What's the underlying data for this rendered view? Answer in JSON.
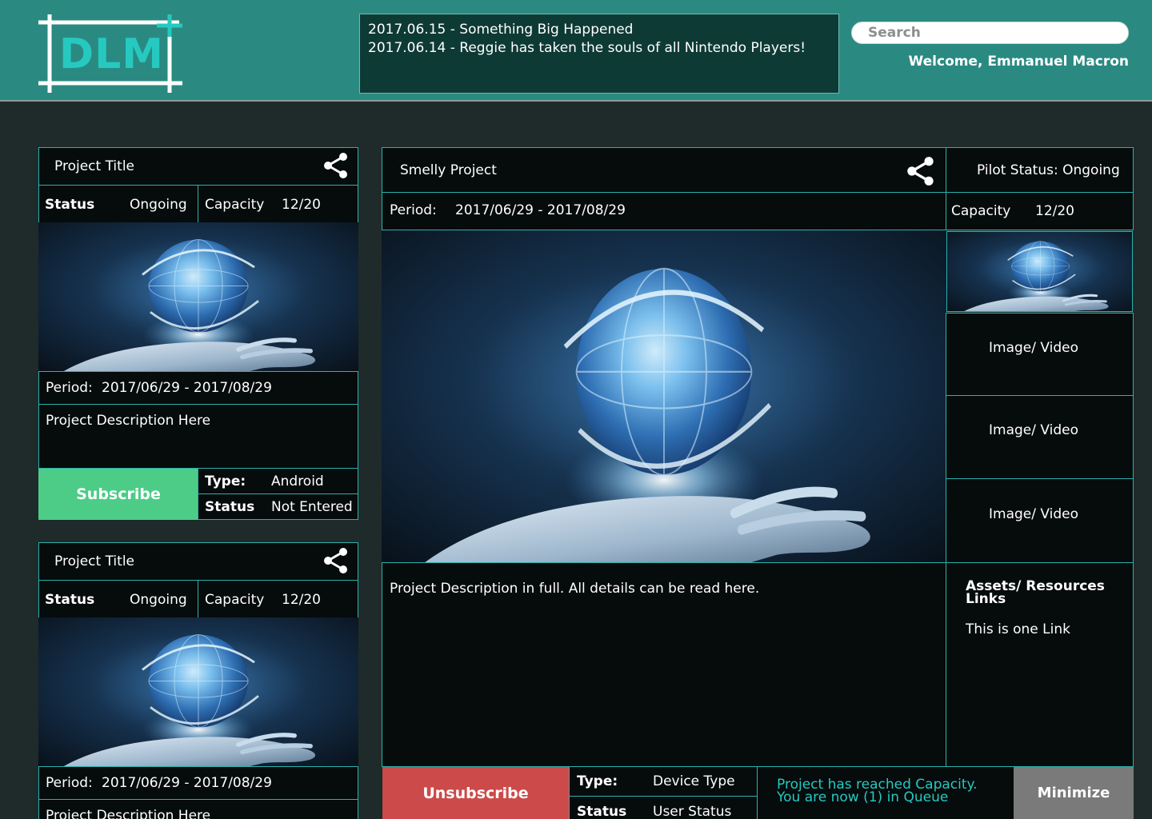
{
  "brand": {
    "logo_text": "DLM"
  },
  "header": {
    "news": [
      "2017.06.15 - Something Big Happened",
      "2017.06.14 - Reggie has taken the souls of all Nintendo Players!"
    ],
    "search_placeholder": "Search",
    "welcome": "Welcome, Emmanuel Macron"
  },
  "cards": [
    {
      "title": "Project Title",
      "status_label": "Status",
      "status_value": "Ongoing",
      "capacity_label": "Capacity",
      "capacity_value": "12/20",
      "period_label": "Period:",
      "period_value": "2017/06/29 - 2017/08/29",
      "description": "Project Description Here",
      "button": "Subscribe",
      "type_label": "Type:",
      "type_value": "Android",
      "user_status_label": "Status",
      "user_status_value": "Not Entered"
    },
    {
      "title": "Project Title",
      "status_label": "Status",
      "status_value": "Ongoing",
      "capacity_label": "Capacity",
      "capacity_value": "12/20",
      "period_label": "Period:",
      "period_value": "2017/06/29 - 2017/08/29",
      "description": "Project Description Here"
    }
  ],
  "detail": {
    "title": "Smelly Project",
    "pilot_status": "Pilot Status: Ongoing",
    "period_label": "Period:",
    "period_value": "2017/06/29 - 2017/08/29",
    "capacity_label": "Capacity",
    "capacity_value": "12/20",
    "media": [
      "Image/ Video",
      "Image/ Video",
      "Image/ Video"
    ],
    "description": "Project Description in full. All details can be read here.",
    "assets_title": "Assets/ Resources Links",
    "assets_link": "This is one Link",
    "unsubscribe": "Unsubscribe",
    "type_label": "Type:",
    "type_value": "Device Type",
    "status_label": "Status",
    "status_value": "User Status",
    "queue_line1": "Project has reached Capacity.",
    "queue_line2": "You are now (1) in Queue",
    "minimize": "Minimize"
  },
  "colors": {
    "header_bg": "#2a8a82",
    "page_bg": "#1f2a2a",
    "border_teal": "#2bb2ad",
    "subscribe": "#4ccc87",
    "unsubscribe": "#cc4a4a",
    "minimize": "#7a7a7a",
    "queue_text": "#26c9c0"
  }
}
